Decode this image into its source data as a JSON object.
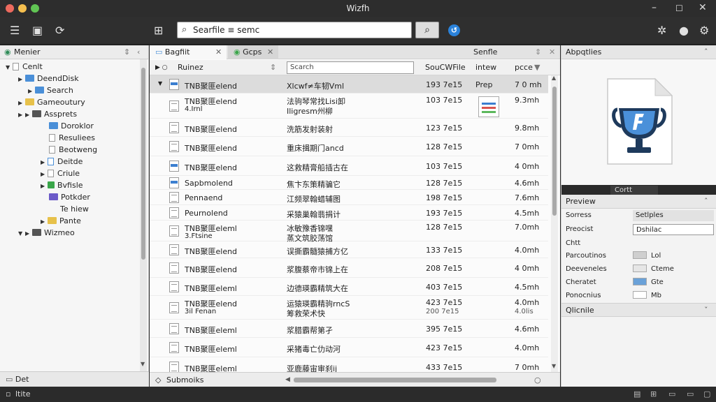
{
  "window": {
    "title": "Wizfh"
  },
  "toolbar": {
    "search_value": "Searfile ≡ semc"
  },
  "left": {
    "header": "Menier",
    "items": [
      {
        "label": "Cenlt"
      },
      {
        "label": "DeendDisk"
      },
      {
        "label": "Search"
      },
      {
        "label": "Gameoutury"
      },
      {
        "label": "Assprets"
      },
      {
        "label": "Doroklor"
      },
      {
        "label": "Resuliees"
      },
      {
        "label": "Beotweng"
      },
      {
        "label": "Deitde"
      },
      {
        "label": "Criule"
      },
      {
        "label": "Bvfisle"
      },
      {
        "label": "Potkder"
      },
      {
        "label": "Te hiew"
      },
      {
        "label": "Pante"
      },
      {
        "label": "Wizmeo"
      }
    ],
    "footer": "Det"
  },
  "center": {
    "tabs": [
      "Bagfiit",
      "Gcps",
      "Senfle"
    ],
    "columns": {
      "name": "Ruinez",
      "filter": "Scarch",
      "size": "SouCWFile",
      "type": "intew",
      "time": "pcce"
    },
    "rows": [
      {
        "name": "TNB聚匪elend",
        "desc": "Xlcwf≠车韧Vml",
        "size": "193 7e15",
        "type": "Prep",
        "time": "7 0 mh"
      },
      {
        "name": "TNB聚匪elend",
        "name2": "4.Irnl",
        "desc": "法驹琴常找Lisi卸",
        "desc2": "Iligresm州柳",
        "size": "103 7e15",
        "type": "",
        "time": "9.3mh"
      },
      {
        "name": "TNB聚匪elend",
        "desc": "洗筋发射装射",
        "size": "123 7e15",
        "type": "",
        "time": "9.8mh"
      },
      {
        "name": "TNB聚匪elend",
        "desc": "重床揖期门ancd",
        "size": "128 7e15",
        "type": "",
        "time": "7 0mh"
      },
      {
        "name": "TNB聚匪elend",
        "desc": "这救精膏船插古在",
        "size": "103 7e15",
        "type": "",
        "time": "4 0mh"
      },
      {
        "name": "Sapbmolend",
        "desc": "焦卞东策精骗它",
        "size": "128 7e15",
        "type": "",
        "time": "4.6mh"
      },
      {
        "name": "Pennaend",
        "desc": "江频翠翰蜡辅图",
        "size": "198 7e15",
        "type": "",
        "time": "7.6mh"
      },
      {
        "name": "Peurnolend",
        "desc": "采猿巢翰翡捐计",
        "size": "193 7e15",
        "type": "",
        "time": "4.5mh"
      },
      {
        "name": "TNB聚匪eleml",
        "name2": "3.Ftsine",
        "desc": "冰敏豫香锦嘿",
        "desc2": "蒸文筑胶荡馆",
        "size": "128 7e15",
        "type": "",
        "time": "7.0mh"
      },
      {
        "name": "TNB聚匪elend",
        "desc": "误撕霸髓猿捕方亿",
        "size": "133 7e15",
        "type": "",
        "time": "4.0mh"
      },
      {
        "name": "TNB聚匪elend",
        "desc": "浆腹蔡帝市锦上在",
        "size": "208 7e15",
        "type": "",
        "time": "4 0mh"
      },
      {
        "name": "TNB聚匪eleml",
        "desc": "边德瑛霸精筑大在",
        "size": "403 7e15",
        "type": "",
        "time": "4.5mh"
      },
      {
        "name": "TNB聚匪elend",
        "name2": "3il Fenan",
        "desc": "运猿瑛霸精驹rncS",
        "desc2": "筹救荣术快",
        "size": "423 7e15",
        "size2": "200 7e15",
        "type": "",
        "time": "4.0mh",
        "time2": "4.0lis"
      },
      {
        "name": "TNB聚匪eleml",
        "desc": "浆腊霸帮第孑",
        "size": "395 7e15",
        "type": "",
        "time": "4.6mh"
      },
      {
        "name": "TNB聚匪eleml",
        "desc": "采猪毒亡仂动河",
        "size": "423 7e15",
        "type": "",
        "time": "4.0mh"
      },
      {
        "name": "TNB聚匪eleml",
        "desc": "亚鹿藤宙审刹ij",
        "size": "433 7e15",
        "type": "",
        "time": "7 0mh"
      }
    ],
    "footer": "Submoiks"
  },
  "right": {
    "header": "Abpqtlies",
    "dark_tab": "Cortt",
    "preview_title": "Preview",
    "props": [
      {
        "label": "Sorress",
        "value": "Setlples"
      },
      {
        "label": "Preocist",
        "value": "Dshilac"
      },
      {
        "label": "Chtt",
        "value": ""
      },
      {
        "label": "Parcoutinos",
        "value": "Lol",
        "color": "#cfcfcf"
      },
      {
        "label": "Deeveneles",
        "value": "Cteme",
        "color": "#e6e6e6"
      },
      {
        "label": "Cheratet",
        "value": "Gte",
        "color": "#6aa1d8"
      },
      {
        "label": "Ponocnius",
        "value": "Mb",
        "color": "#ffffff"
      }
    ],
    "section2": "Qlicnile",
    "accent": "#2a82da"
  },
  "status": {
    "text": "ltite"
  }
}
